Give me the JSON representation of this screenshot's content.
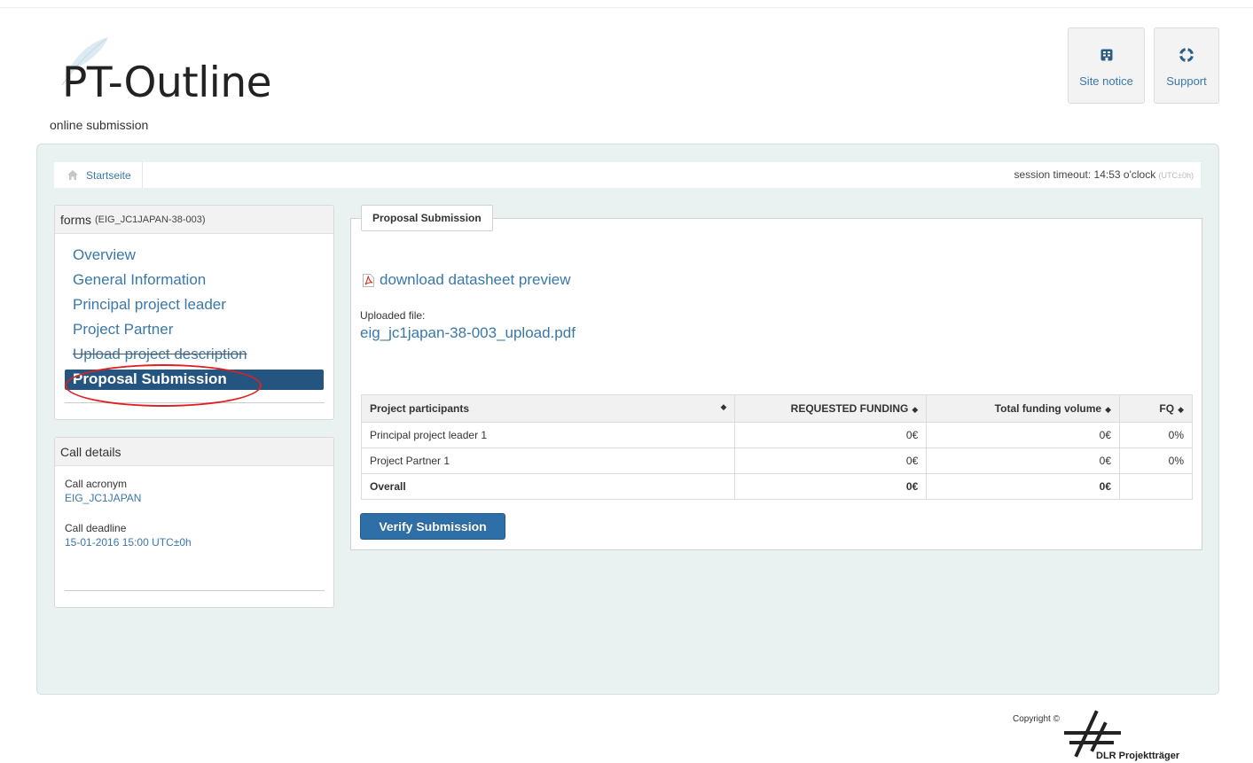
{
  "header": {
    "logo_text": "PT-Outline",
    "tagline": "online submission",
    "site_notice_label": "Site notice",
    "support_label": "Support"
  },
  "breadcrumb": {
    "home_label": "Startseite"
  },
  "session": {
    "text": "session timeout: 14:53 o'clock",
    "tz": "(UTC±0h)"
  },
  "sidebar": {
    "forms_title": "forms",
    "forms_id": "(EIG_JC1JAPAN-38-003)",
    "items": [
      {
        "label": "Overview"
      },
      {
        "label": "General Information"
      },
      {
        "label": "Principal project leader"
      },
      {
        "label": "Project Partner"
      },
      {
        "label": "Upload project description"
      },
      {
        "label": "Proposal Submission"
      }
    ],
    "active_index": 5
  },
  "call_details": {
    "title": "Call details",
    "acronym_label": "Call acronym",
    "acronym_value": "EIG_JC1JAPAN",
    "deadline_label": "Call deadline",
    "deadline_value": "15-01-2016 15:00 UTC±0h"
  },
  "proposal": {
    "legend": "Proposal Submission",
    "download_label": "download datasheet preview",
    "uploaded_label": "Uploaded file:",
    "uploaded_file": "eig_jc1japan-38-003_upload.pdf",
    "table": {
      "headers": [
        "Project participants",
        "REQUESTED FUNDING",
        "Total funding volume",
        "FQ"
      ],
      "rows": [
        [
          "Principal project leader 1",
          "0€",
          "0€",
          "0%"
        ],
        [
          "Project Partner 1",
          "0€",
          "0€",
          "0%"
        ],
        [
          "Overall",
          "0€",
          "0€",
          ""
        ]
      ]
    },
    "verify_label": "Verify Submission"
  },
  "footer": {
    "copyright": "Copyright ©",
    "brand": "DLR  Projektträger"
  },
  "colors": {
    "link": "#3a78a8",
    "active_nav": "#245580",
    "verify_button": "#2f6fa7",
    "highlight_oval": "#e02020"
  }
}
